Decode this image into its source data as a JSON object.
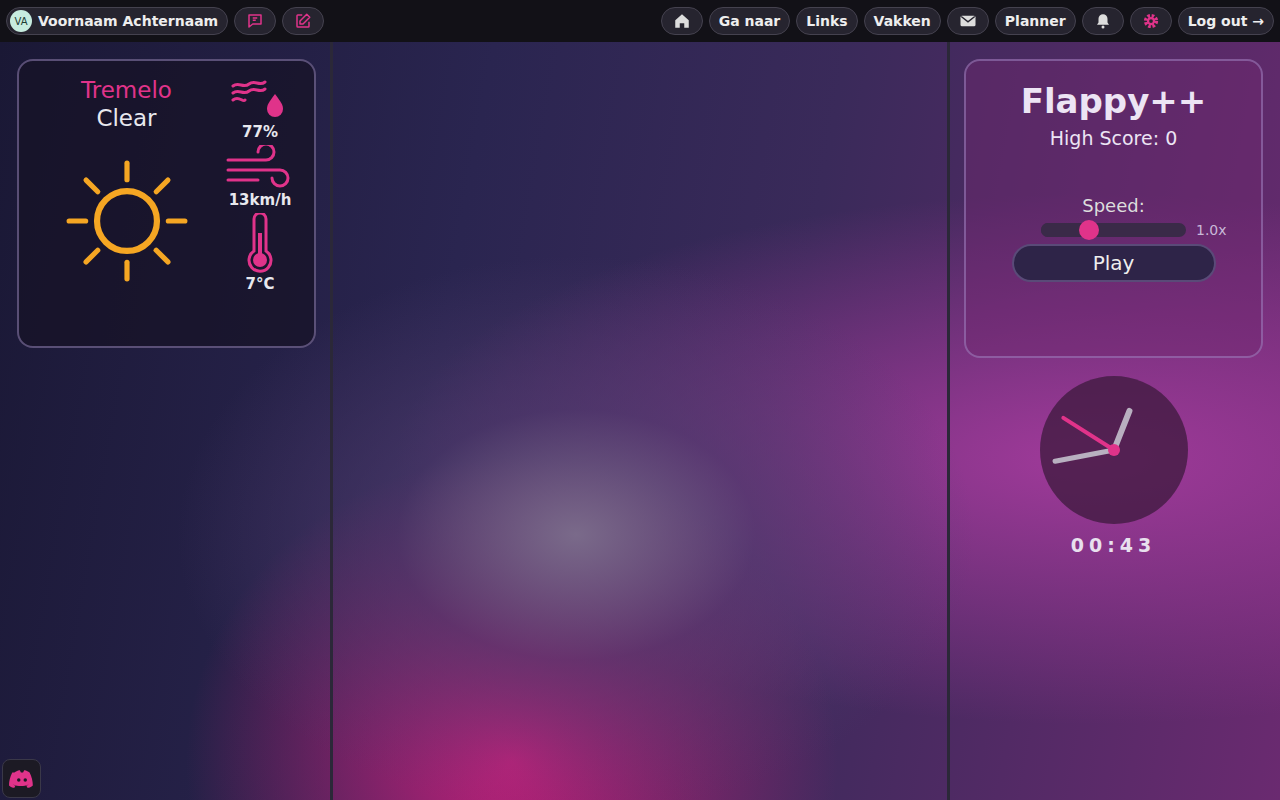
{
  "user": {
    "initials": "VA",
    "name": "Voornaam Achternaam"
  },
  "nav": {
    "links": [
      "Ga naar",
      "Links",
      "Vakken",
      "Planner"
    ],
    "logout": "Log out →"
  },
  "weather": {
    "city": "Tremelo",
    "condition": "Clear",
    "humidity": "77%",
    "wind": "13km/h",
    "temperature": "7°C"
  },
  "game": {
    "title": "Flappy++",
    "high_score": "High Score: 0",
    "speed_label": "Speed:",
    "speed": {
      "level": 0.33,
      "reading": "1.0x"
    },
    "play": "Play"
  },
  "clock": {
    "hands": {
      "hour": 0.06,
      "minute": 0.72,
      "second": 0.84
    },
    "time": "00:43"
  }
}
